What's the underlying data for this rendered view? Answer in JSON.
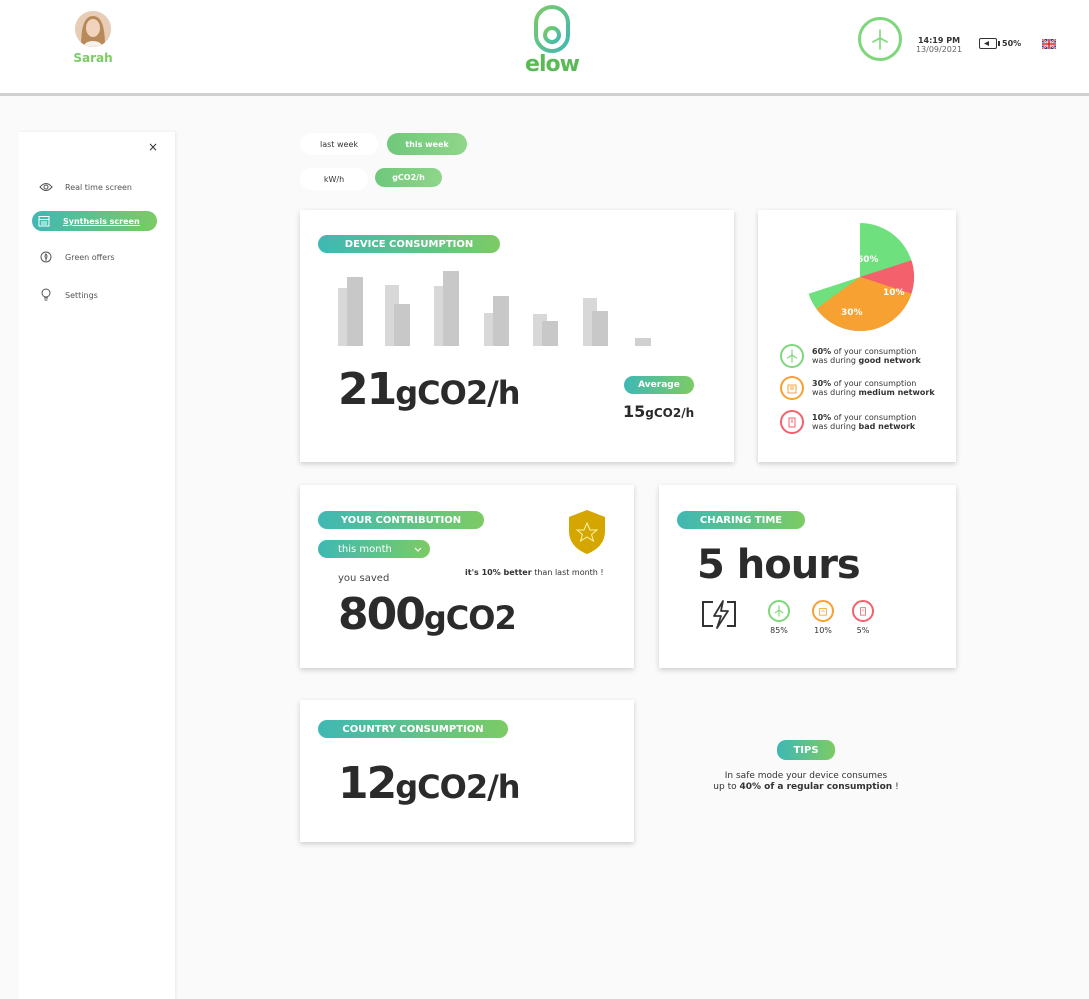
{
  "header": {
    "user_name": "Sarah",
    "logo_text": "elow",
    "time": "14:19 PM",
    "date": "13/09/2021",
    "battery": "50%"
  },
  "sidebar": {
    "close_label": "×",
    "items": [
      {
        "label": "Real time screen",
        "icon": "eye-icon"
      },
      {
        "label": "Synthesis screen",
        "icon": "calendar-icon"
      },
      {
        "label": "Green offers",
        "icon": "leaf-icon"
      },
      {
        "label": "Settings",
        "icon": "bulb-icon"
      }
    ]
  },
  "filters": {
    "period": [
      "last week",
      "this week"
    ],
    "unit": [
      "kW/h",
      "gCO2/h"
    ]
  },
  "device_consumption": {
    "title": "DEVICE CONSUMPTION",
    "value": "21",
    "unit": "gCO2/h",
    "average_label": "Average",
    "average_value": "15",
    "average_unit": "gCO2/h"
  },
  "network_breakdown": {
    "pie": [
      {
        "label": "60%",
        "value": 60,
        "color": "#6fe07e"
      },
      {
        "label": "30%",
        "value": 30,
        "color": "#f7a133"
      },
      {
        "label": "10%",
        "value": 10,
        "color": "#f4606b"
      }
    ],
    "legend": [
      {
        "pct": "60%",
        "pre": " of your consumption",
        "line2": "was during ",
        "quality": "good network",
        "color": "#7ed77a"
      },
      {
        "pct": "30%",
        "pre": " of your consumption",
        "line2": "was during ",
        "quality": "medium network",
        "color": "#f7a133"
      },
      {
        "pct": "10%",
        "pre": " of your consumption",
        "line2": "was during ",
        "quality": "bad network",
        "color": "#f4606b"
      }
    ]
  },
  "contribution": {
    "title": "YOUR CONTRIBUTION",
    "period": "this month",
    "saved_label": "you saved",
    "value": "800",
    "unit": "gCO2",
    "better_bold": "it's 10% better",
    "better_rest": " than last month !"
  },
  "charging": {
    "title": "CHARING TIME",
    "value": "5 hours",
    "splits": [
      {
        "pct": "85%",
        "color": "#7ed77a"
      },
      {
        "pct": "10%",
        "color": "#f7a133"
      },
      {
        "pct": "5%",
        "color": "#f4606b"
      }
    ]
  },
  "country": {
    "title": "COUNTRY CONSUMPTION",
    "value": "12",
    "unit": "gCO2/h"
  },
  "tips": {
    "title": "TIPS",
    "line1": "In safe mode your device consumes",
    "line2_pre": "up to ",
    "line2_bold": "40% of a regular consumption",
    "line2_post": " !"
  }
}
